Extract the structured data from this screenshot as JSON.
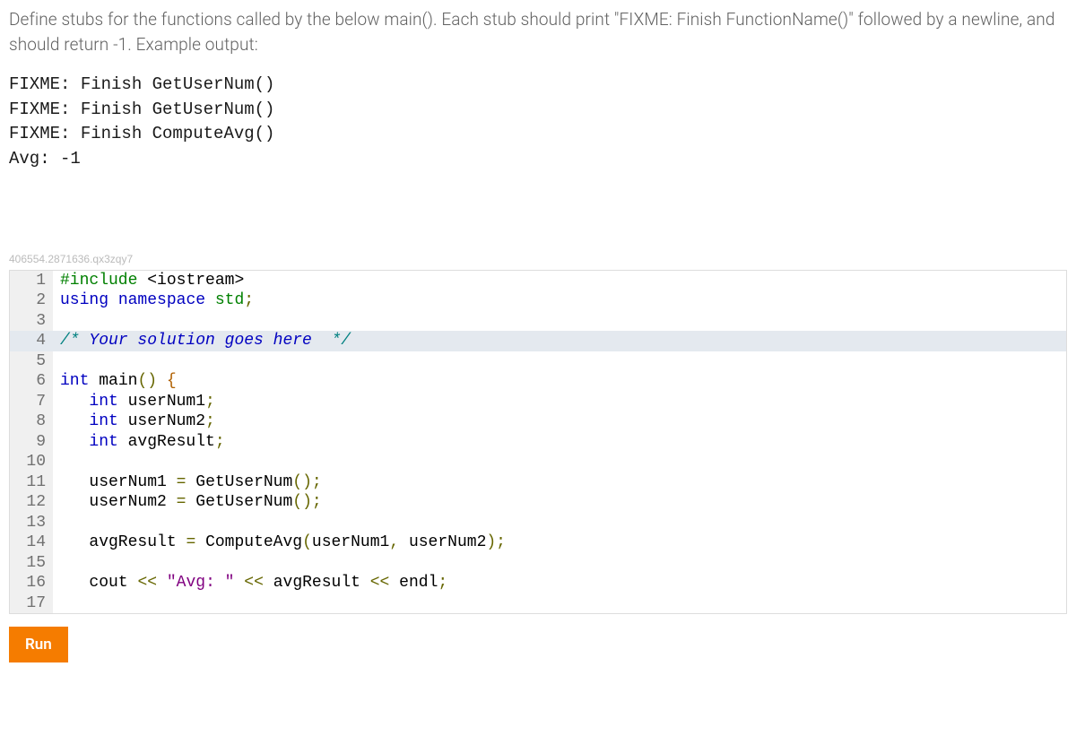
{
  "instructions": "Define stubs for the functions called by the below main(). Each stub should print \"FIXME: Finish FunctionName()\" followed by a newline, and should return -1. Example output:",
  "example_output": "FIXME: Finish GetUserNum()\nFIXME: Finish GetUserNum()\nFIXME: Finish ComputeAvg()\nAvg: -1",
  "watermark": "406554.2871636.qx3zqy7",
  "run_label": "Run",
  "code": {
    "lines": [
      {
        "n": "1",
        "hl": false,
        "html": "<span class='tok-pp'>#include</span> <span class='tok-id'>&lt;iostream&gt;</span>"
      },
      {
        "n": "2",
        "hl": false,
        "html": "<span class='tok-kw'>using</span> <span class='tok-kw'>namespace</span> <span class='tok-ns'>std</span><span class='tok-punc'>;</span>"
      },
      {
        "n": "3",
        "hl": false,
        "html": ""
      },
      {
        "n": "4",
        "hl": true,
        "html": "<span class='tok-cm-delim'>/*</span><span class='tok-cm'> Your solution goes here  </span><span class='tok-cm-delim'>*/</span>"
      },
      {
        "n": "5",
        "hl": false,
        "html": ""
      },
      {
        "n": "6",
        "hl": false,
        "html": "<span class='tok-kw'>int</span> <span class='tok-id'>main</span><span class='tok-punc'>()</span> <span class='tok-brace'>{</span>"
      },
      {
        "n": "7",
        "hl": false,
        "html": "   <span class='tok-kw'>int</span> <span class='tok-id'>userNum1</span><span class='tok-punc'>;</span>"
      },
      {
        "n": "8",
        "hl": false,
        "html": "   <span class='tok-kw'>int</span> <span class='tok-id'>userNum2</span><span class='tok-punc'>;</span>"
      },
      {
        "n": "9",
        "hl": false,
        "html": "   <span class='tok-kw'>int</span> <span class='tok-id'>avgResult</span><span class='tok-punc'>;</span>"
      },
      {
        "n": "10",
        "hl": false,
        "html": ""
      },
      {
        "n": "11",
        "hl": false,
        "html": "   <span class='tok-id'>userNum1</span> <span class='tok-op'>=</span> <span class='tok-id'>GetUserNum</span><span class='tok-punc'>();</span>"
      },
      {
        "n": "12",
        "hl": false,
        "html": "   <span class='tok-id'>userNum2</span> <span class='tok-op'>=</span> <span class='tok-id'>GetUserNum</span><span class='tok-punc'>();</span>"
      },
      {
        "n": "13",
        "hl": false,
        "html": ""
      },
      {
        "n": "14",
        "hl": false,
        "html": "   <span class='tok-id'>avgResult</span> <span class='tok-op'>=</span> <span class='tok-id'>ComputeAvg</span><span class='tok-punc'>(</span><span class='tok-id'>userNum1</span><span class='tok-punc'>,</span> <span class='tok-id'>userNum2</span><span class='tok-punc'>);</span>"
      },
      {
        "n": "15",
        "hl": false,
        "html": ""
      },
      {
        "n": "16",
        "hl": false,
        "html": "   <span class='tok-id'>cout</span> <span class='tok-op'>&lt;&lt;</span> <span class='tok-str'>\"Avg: \"</span> <span class='tok-op'>&lt;&lt;</span> <span class='tok-id'>avgResult</span> <span class='tok-op'>&lt;&lt;</span> <span class='tok-id'>endl</span><span class='tok-punc'>;</span>"
      },
      {
        "n": "17",
        "hl": false,
        "html": ""
      }
    ]
  }
}
